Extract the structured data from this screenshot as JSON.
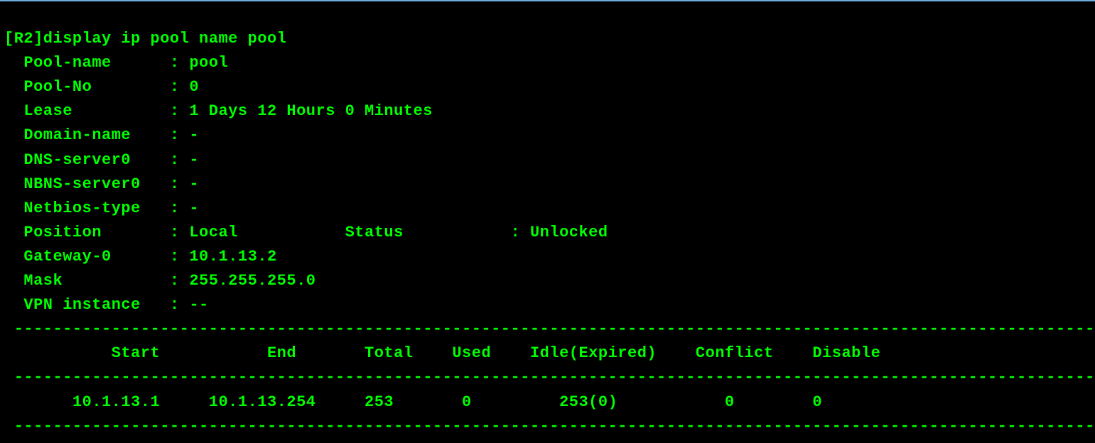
{
  "prompt_line": "[R2]display ip pool name pool",
  "fields": {
    "pool_name": {
      "label": "Pool-name",
      "value": "pool"
    },
    "pool_no": {
      "label": "Pool-No",
      "value": "0"
    },
    "lease": {
      "label": "Lease",
      "value": "1 Days 12 Hours 0 Minutes"
    },
    "domain_name": {
      "label": "Domain-name",
      "value": "-"
    },
    "dns_server0": {
      "label": "DNS-server0",
      "value": "-"
    },
    "nbns_server0": {
      "label": "NBNS-server0",
      "value": "-"
    },
    "netbios_type": {
      "label": "Netbios-type",
      "value": "-"
    },
    "position": {
      "label": "Position",
      "value": "Local"
    },
    "status": {
      "label": "Status",
      "value": "Unlocked"
    },
    "gateway_0": {
      "label": "Gateway-0",
      "value": "10.1.13.2"
    },
    "mask": {
      "label": "Mask",
      "value": "255.255.255.0"
    },
    "vpn_instance": {
      "label": "VPN instance",
      "value": "--"
    }
  },
  "table": {
    "headers": {
      "start": "Start",
      "end": "End",
      "total": "Total",
      "used": "Used",
      "idle_expired": "Idle(Expired)",
      "conflict": "Conflict",
      "disable": "Disable"
    },
    "row": {
      "start": "10.1.13.1",
      "end": "10.1.13.254",
      "total": "253",
      "used": "0",
      "idle_expired": "253(0)",
      "conflict": "0",
      "disable": "0"
    }
  },
  "separator": " -----------------------------------------------------------------------------------------------------------------"
}
